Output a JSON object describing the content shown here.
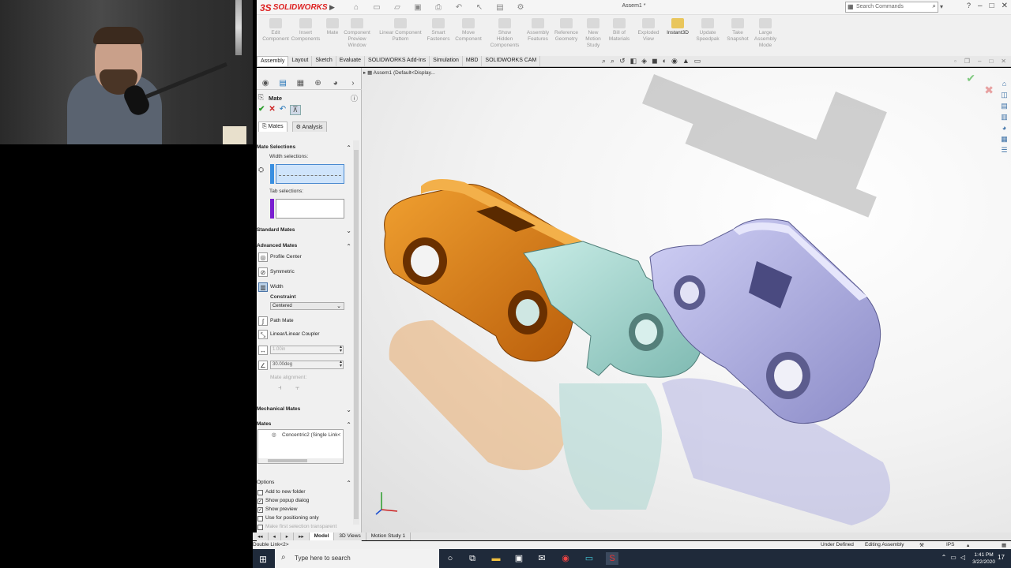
{
  "app": {
    "name": "SOLIDWORKS",
    "brand_prefix": "3S",
    "doc_title": "Assem1 *",
    "search_placeholder": "Search Commands"
  },
  "colors": {
    "brand_red": "#cc2222",
    "part_orange": "#d97a12",
    "part_teal": "#9ed3cc",
    "part_lavender": "#a8a8e0",
    "active_selection": "#cfe4fb",
    "taskbar": "#1f2a3a"
  },
  "command_manager": [
    {
      "label": "Edit\nComponent"
    },
    {
      "label": "Insert\nComponents"
    },
    {
      "label": "Mate"
    },
    {
      "label": "Component\nPreview\nWindow"
    },
    {
      "label": "Linear Component\nPattern"
    },
    {
      "label": "Smart\nFasteners"
    },
    {
      "label": "Move\nComponent"
    },
    {
      "label": "Show\nHidden\nComponents"
    },
    {
      "label": "Assembly\nFeatures"
    },
    {
      "label": "Reference\nGeometry"
    },
    {
      "label": "New\nMotion\nStudy"
    },
    {
      "label": "Bill of\nMaterials"
    },
    {
      "label": "Exploded\nView"
    },
    {
      "label": "Instant3D"
    },
    {
      "label": "Update\nSpeedpak"
    },
    {
      "label": "Take\nSnapshot"
    },
    {
      "label": "Large\nAssembly\nMode"
    }
  ],
  "tabs": [
    "Assembly",
    "Layout",
    "Sketch",
    "Evaluate",
    "SOLIDWORKS Add-Ins",
    "Simulation",
    "MBD",
    "SOLIDWORKS CAM"
  ],
  "property_manager": {
    "title": "Mate",
    "subtabs": [
      "Mates",
      "Analysis"
    ],
    "mate_selections": {
      "header": "Mate Selections",
      "width_label": "Width selections:",
      "tab_label": "Tab selections:"
    },
    "standard_mates": "Standard Mates",
    "advanced_mates": {
      "header": "Advanced Mates",
      "items": [
        "Profile Center",
        "Symmetric",
        "Width"
      ],
      "constraint_label": "Constraint",
      "constraint_value": "Centered",
      "items2": [
        "Path Mate",
        "Linear/Linear Coupler"
      ],
      "distance_value": "1.00in",
      "angle_value": "30.00deg",
      "mate_alignment": "Mate alignment:"
    },
    "mechanical_mates": "Mechanical Mates",
    "mates": {
      "header": "Mates",
      "items": [
        "Concentric2 (Single Link<"
      ]
    },
    "options": {
      "header": "Options",
      "items": [
        {
          "label": "Add to new folder",
          "checked": false
        },
        {
          "label": "Show popup dialog",
          "checked": true
        },
        {
          "label": "Show preview",
          "checked": true
        },
        {
          "label": "Use for positioning only",
          "checked": false
        }
      ],
      "cut_off": "Make first selection transparent"
    }
  },
  "viewport": {
    "tree_label": "Assem1 (Default<Display..."
  },
  "bottom_tabs": [
    "Model",
    "3D Views",
    "Motion Study 1"
  ],
  "status": {
    "left": "Double Link<2>",
    "under_defined": "Under Defined",
    "mode": "Editing Assembly",
    "units": "IPS"
  },
  "taskbar": {
    "search_placeholder": "Type here to search",
    "time": "1:41 PM",
    "date": "3/22/2020",
    "badge": "17"
  }
}
